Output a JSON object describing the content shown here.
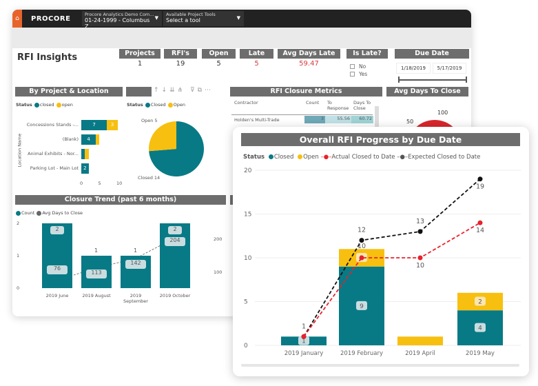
{
  "colors": {
    "closed": "#087a86",
    "open": "#f7bf0f",
    "actual": "#e8212a",
    "expected": "#111111",
    "header": "#6d6d6d",
    "accent": "#e8632b",
    "late": "#d9383f"
  },
  "topbar": {
    "home_icon": "home-icon",
    "logo": "PROCORE",
    "project": {
      "label": "Procore Analytics Demo Com...",
      "value": "01-24-1999 - Columbus Z..."
    },
    "tools": {
      "label": "Available Project Tools",
      "value": "Select a tool"
    }
  },
  "page_title": "RFI Insights",
  "kpis": [
    {
      "label": "Projects",
      "value": "1"
    },
    {
      "label": "RFI's",
      "value": "19"
    },
    {
      "label": "Open",
      "value": "5"
    },
    {
      "label": "Late",
      "value": "5"
    },
    {
      "label": "Avg Days Late",
      "value": "59.47"
    }
  ],
  "is_late": {
    "label": "Is Late?",
    "options": [
      "No",
      "Yes"
    ]
  },
  "due_date": {
    "label": "Due Date",
    "start": "1/18/2019",
    "end": "5/17/2019"
  },
  "by_location": {
    "title": "By Project & Location",
    "legend_title": "Status",
    "legend": [
      "closed",
      "open"
    ],
    "axis_label": "Location Name",
    "chart_data": {
      "type": "bar",
      "orientation": "horizontal",
      "stacked": true,
      "categories": [
        "Concessions Stands -...",
        "(Blank)",
        "Animal Exhibits - Nor...",
        "Parking Lot - Main Lot"
      ],
      "series": [
        {
          "name": "closed",
          "values": [
            7,
            4,
            1,
            2
          ]
        },
        {
          "name": "open",
          "values": [
            3,
            1,
            1,
            0
          ]
        }
      ],
      "xticks": [
        "0",
        "5",
        "10"
      ],
      "xlim": [
        0,
        10
      ]
    }
  },
  "status_pie": {
    "legend_title": "Status",
    "legend": [
      "Closed",
      "Open"
    ],
    "chart_data": {
      "type": "pie",
      "slices": [
        {
          "name": "Closed",
          "value": 14,
          "label": "Closed 14"
        },
        {
          "name": "Open",
          "value": 5,
          "label": "Open 5"
        }
      ]
    }
  },
  "closure_metrics": {
    "title": "RFI Closure Metrics",
    "columns": [
      "Contractor",
      "Count",
      "To Response",
      "Days To Close"
    ],
    "rows": [
      [
        "Holden's Multi-Trade",
        "3",
        "55.56",
        "60.72"
      ]
    ]
  },
  "avg_days": {
    "title": "Avg Days To Close",
    "ticks": [
      "50",
      "100"
    ]
  },
  "closure_trend": {
    "title": "Closure Trend (past 6 months)",
    "legend": [
      "Count",
      "Avg Days to Close"
    ],
    "chart_data": {
      "type": "bar",
      "categories": [
        "2019 June",
        "2019 August",
        "2019 September",
        "2019 October"
      ],
      "series": [
        {
          "name": "Count",
          "values": [
            2,
            1,
            1,
            2
          ]
        },
        {
          "name": "Avg Days to Close",
          "type": "line",
          "values": [
            76,
            113,
            142,
            204
          ]
        }
      ],
      "yticks": [
        "0",
        "1",
        "2"
      ],
      "y2ticks": [
        "100",
        "200"
      ],
      "ylim": [
        0,
        2
      ]
    }
  },
  "progress": {
    "title": "Overall RFI Progress by Due Date",
    "legend_title": "Status",
    "legend": [
      "Closed",
      "Open",
      "Actual Closed to Date",
      "Expected Closed to Date"
    ],
    "chart_data": {
      "type": "bar",
      "stacked": true,
      "categories": [
        "2019 January",
        "2019 February",
        "2019 April",
        "2019 May"
      ],
      "series": [
        {
          "name": "Closed",
          "values": [
            1,
            9,
            0,
            4
          ]
        },
        {
          "name": "Open",
          "values": [
            0,
            2,
            1,
            2
          ]
        },
        {
          "name": "Actual Closed to Date",
          "type": "line",
          "values": [
            1,
            10,
            10,
            14
          ]
        },
        {
          "name": "Expected Closed to Date",
          "type": "line",
          "values": [
            1,
            12,
            13,
            19
          ]
        }
      ],
      "yticks": [
        "0",
        "5",
        "10",
        "15",
        "20"
      ],
      "ylim": [
        0,
        20
      ]
    }
  }
}
